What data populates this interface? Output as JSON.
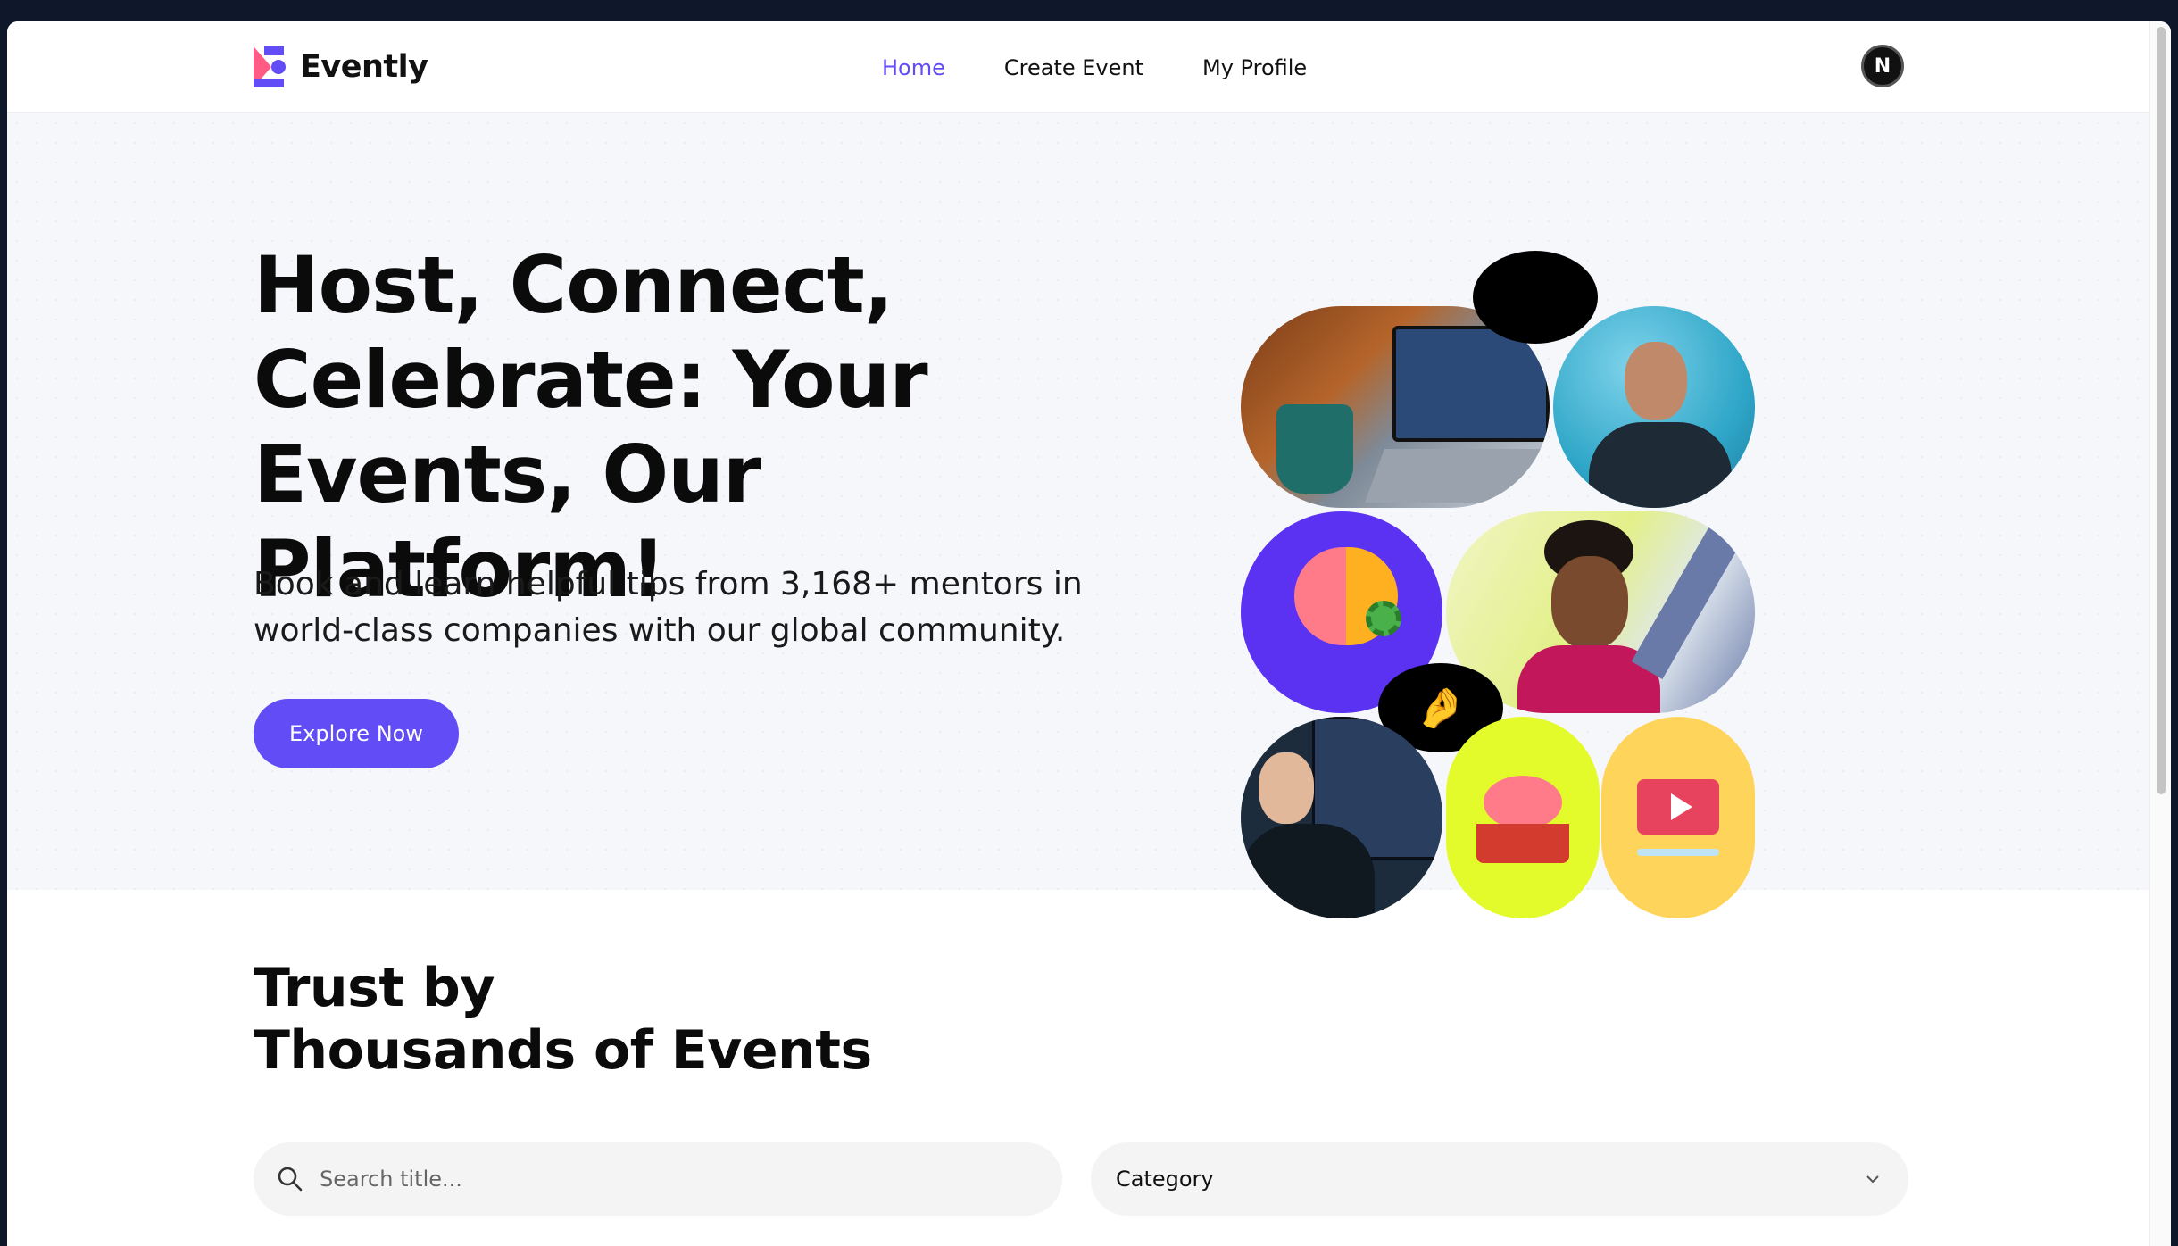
{
  "brand": {
    "name": "Evently",
    "accent": "#624cf5"
  },
  "nav": {
    "items": [
      {
        "label": "Home",
        "active": true
      },
      {
        "label": "Create Event",
        "active": false
      },
      {
        "label": "My Profile",
        "active": false
      }
    ]
  },
  "user": {
    "avatar_initial": "N"
  },
  "hero": {
    "title_line1": "Host, Connect,",
    "title_line2": "Celebrate: Your",
    "title_line3": "Events, Our Platform!",
    "subtitle_line1": "Book and learn helpful tips from 3,168+ mentors in",
    "subtitle_line2": "world-class companies with our global community.",
    "cta_label": "Explore Now"
  },
  "collage": {
    "bubble_top_emoji": "😍",
    "bubble_mid_emoji": "🤌"
  },
  "trust": {
    "title_line1": "Trust by",
    "title_line2": "Thousands of Events"
  },
  "filters": {
    "search_placeholder": "Search title...",
    "category_label": "Category"
  }
}
